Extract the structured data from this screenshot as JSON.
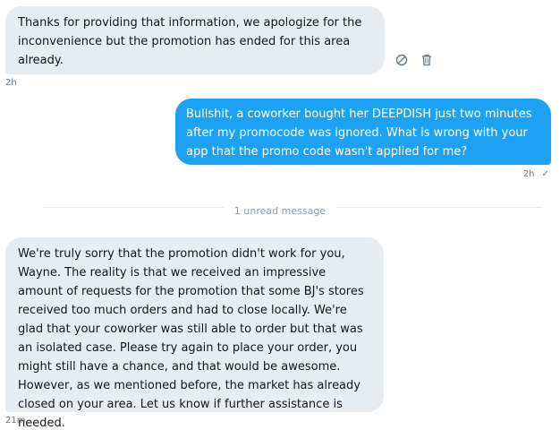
{
  "messages": [
    {
      "text": "Thanks for providing that information, we apologize for the inconvenience but the promotion has ended for this area already.",
      "time": "2h"
    },
    {
      "text": "Bullshit, a coworker bought her DEEPDISH just two minutes after my promocode was ignored. What is wrong with your app that the promo code wasn't applied for me?",
      "time": "2h",
      "status": "✓"
    },
    {
      "text": "We're truly sorry that the promotion didn't work for you, Wayne. The reality is that we received an impressive amount of requests for the promotion that some BJ's stores received too much orders and had to close locally. We're glad that your coworker was still able to order but that was an isolated case. Please try again to place your order, you might still have a chance, and that would be awesome. However, as we mentioned before, the market has already closed on your area. Let us know if further assistance is needed.",
      "time": "21m"
    }
  ],
  "divider": {
    "label": "1 unread message"
  },
  "icons": {
    "report": "report-icon",
    "delete": "trash-icon"
  },
  "colors": {
    "incoming_bubble": "#e6ecf0",
    "outgoing_bubble": "#1da1f2",
    "meta_text": "#657786"
  }
}
